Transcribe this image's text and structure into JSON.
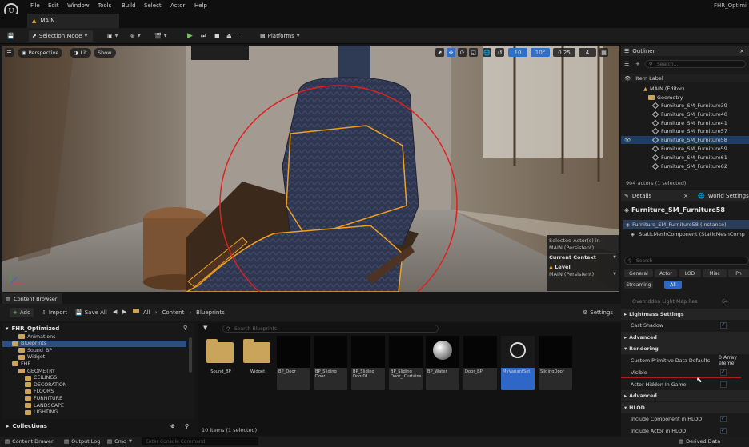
{
  "app": {
    "logo_letter": "U",
    "project_title": "FHR_Optimi",
    "level_tab": "MAIN",
    "menu": [
      "File",
      "Edit",
      "Window",
      "Tools",
      "Build",
      "Select",
      "Actor",
      "Help"
    ]
  },
  "toolbar": {
    "mode_label": "Selection Mode",
    "platforms_label": "Platforms"
  },
  "viewport": {
    "perspective": "Perspective",
    "lit": "Lit",
    "show": "Show",
    "grid_snap": "10",
    "rot_snap": "10°",
    "scale_snap": "0.25",
    "cam_speed": "4",
    "selected_info": "Selected Actor(s) in",
    "selected_level": "MAIN (Persistent)",
    "current_context": "Current Context",
    "level_label": "Level",
    "level_value": "MAIN (Persistent)"
  },
  "outliner": {
    "tab": "Outliner",
    "search_placeholder": "Search...",
    "header": "Item Label",
    "root": "MAIN (Editor)",
    "folder": "Geometry",
    "items": [
      "Furniture_SM_Furniture39",
      "Furniture_SM_Furniture40",
      "Furniture_SM_Furniture41",
      "Furniture_SM_Furniture57",
      "Furniture_SM_Furniture58",
      "Furniture_SM_Furniture59",
      "Furniture_SM_Furniture61",
      "Furniture_SM_Furniture62"
    ],
    "footer": "904 actors (1 selected)"
  },
  "details": {
    "tab": "Details",
    "tab2": "World Settings",
    "object_name": "Furniture_SM_Furniture58",
    "instance": "Furniture_SM_Furniture58 (Instance)",
    "component": "StaticMeshComponent (StaticMeshComp",
    "search_placeholder": "Search",
    "filters": [
      "General",
      "Actor",
      "LOD",
      "Misc",
      "Ph"
    ],
    "filters2": [
      "Streaming",
      "All"
    ],
    "cropped_row": "Overridden Light Map Res",
    "cropped_value": "64",
    "rows": [
      {
        "label": "Lightmass Settings",
        "type": "cat"
      },
      {
        "label": "Cast Shadow",
        "type": "chk"
      },
      {
        "label": "Advanced",
        "type": "cat"
      },
      {
        "label": "Rendering",
        "type": "cat"
      },
      {
        "label": "Custom Primitive Data Defaults",
        "type": "val",
        "value": "0 Array eleme"
      },
      {
        "label": "Visible",
        "type": "chk"
      },
      {
        "label": "Actor Hidden In Game",
        "type": "chk-off"
      },
      {
        "label": "Advanced",
        "type": "cat"
      },
      {
        "label": "HLOD",
        "type": "cat"
      },
      {
        "label": "Include Component in HLOD",
        "type": "chk"
      },
      {
        "label": "Include Actor in HLOD",
        "type": "chk"
      }
    ]
  },
  "content_browser": {
    "tab": "Content Browser",
    "add": "Add",
    "import": "Import",
    "save_all": "Save All",
    "breadcrumb": [
      "All",
      "Content",
      "Blueprints"
    ],
    "settings": "Settings",
    "root": "FHR_Optimized",
    "search_placeholder": "Search Blueprints",
    "tree": [
      {
        "label": "Animations",
        "depth": 2
      },
      {
        "label": "Blueprints",
        "depth": 1,
        "selected": true
      },
      {
        "label": "Sound_BP",
        "depth": 2
      },
      {
        "label": "Widget",
        "depth": 2
      },
      {
        "label": "FHR",
        "depth": 1
      },
      {
        "label": "GEOMETRY",
        "depth": 2
      },
      {
        "label": "CEILINGS",
        "depth": 3
      },
      {
        "label": "DECORATION",
        "depth": 3
      },
      {
        "label": "FLOORS",
        "depth": 3
      },
      {
        "label": "FURNITURE",
        "depth": 3
      },
      {
        "label": "LANDSCAPE",
        "depth": 3
      },
      {
        "label": "LIGHTING",
        "depth": 3
      }
    ],
    "collections": "Collections",
    "assets": [
      {
        "label": "Sound_BP",
        "kind": "folder"
      },
      {
        "label": "Widget",
        "kind": "folder"
      },
      {
        "label": "BP_Door",
        "kind": "bp"
      },
      {
        "label": "BP_Sliding Door",
        "kind": "bp"
      },
      {
        "label": "BP_Sliding Door01",
        "kind": "bp"
      },
      {
        "label": "BP_Sliding Door_ Curtains",
        "kind": "bp"
      },
      {
        "label": "BP_Water",
        "kind": "bp"
      },
      {
        "label": "Door_BP",
        "kind": "bp"
      },
      {
        "label": "MyVariantSet",
        "kind": "bp",
        "selected": true
      },
      {
        "label": "SlidingDoor",
        "kind": "bp"
      }
    ],
    "count": "10 items (1 selected)"
  },
  "statusbar": {
    "drawer": "Content Drawer",
    "output": "Output Log",
    "cmd": "Cmd",
    "console_placeholder": "Enter Console Command",
    "derived": "Derived Data"
  },
  "colors": {
    "accent_blue": "#2e67c8",
    "selection_outline": "#f0a020",
    "annotation_red": "#e02020",
    "play_green": "#6ec25b"
  }
}
